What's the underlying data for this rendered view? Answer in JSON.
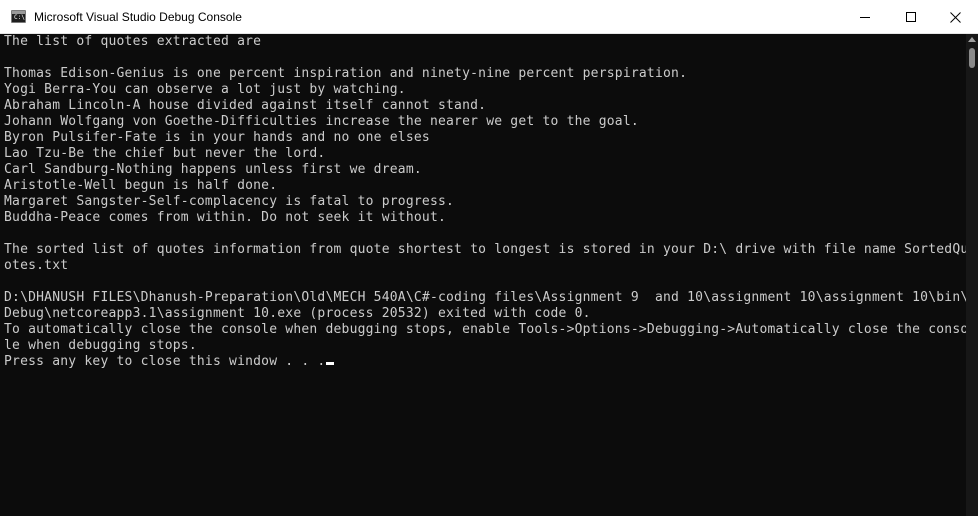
{
  "window": {
    "title": "Microsoft Visual Studio Debug Console",
    "app_icon": "console-app-icon",
    "app_icon_glyph": "C:\\"
  },
  "caption_buttons": {
    "minimize": "minimize-icon",
    "maximize": "maximize-icon",
    "close": "close-icon"
  },
  "console": {
    "lines": [
      "The list of quotes extracted are",
      "",
      "Thomas Edison-Genius is one percent inspiration and ninety-nine percent perspiration.",
      "Yogi Berra-You can observe a lot just by watching.",
      "Abraham Lincoln-A house divided against itself cannot stand.",
      "Johann Wolfgang von Goethe-Difficulties increase the nearer we get to the goal.",
      "Byron Pulsifer-Fate is in your hands and no one elses",
      "Lao Tzu-Be the chief but never the lord.",
      "Carl Sandburg-Nothing happens unless first we dream.",
      "Aristotle-Well begun is half done.",
      "Margaret Sangster-Self-complacency is fatal to progress.",
      "Buddha-Peace comes from within. Do not seek it without.",
      "",
      "The sorted list of quotes information from quote shortest to longest is stored in your D:\\ drive with file name SortedQu",
      "otes.txt",
      "",
      "D:\\DHANUSH FILES\\Dhanush-Preparation\\Old\\MECH 540A\\C#-coding files\\Assignment 9  and 10\\assignment 10\\assignment 10\\bin\\",
      "Debug\\netcoreapp3.1\\assignment 10.exe (process 20532) exited with code 0.",
      "To automatically close the console when debugging stops, enable Tools->Options->Debugging->Automatically close the conso",
      "le when debugging stops.",
      "Press any key to close this window . . ."
    ]
  },
  "colors": {
    "background": "#0c0c0c",
    "text": "#cccccc",
    "titlebar": "#ffffff"
  }
}
